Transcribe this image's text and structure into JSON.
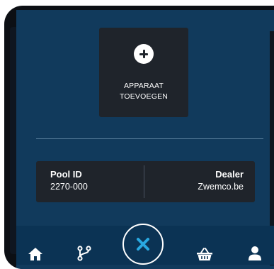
{
  "main": {
    "add_device_label_line1": "APPARAAT",
    "add_device_label_line2": "TOEVOEGEN"
  },
  "info": {
    "pool_id_title": "Pool ID",
    "pool_id_value": "2270-000",
    "dealer_title": "Dealer",
    "dealer_value": "Zwemco.be"
  },
  "nav": {
    "items": [
      "home-icon",
      "branch-icon",
      "close-icon",
      "basket-icon",
      "user-icon"
    ]
  },
  "colors": {
    "background": "#113a5c",
    "card": "#1f242b",
    "accent": "#29a8e0",
    "text": "#ffffff"
  }
}
